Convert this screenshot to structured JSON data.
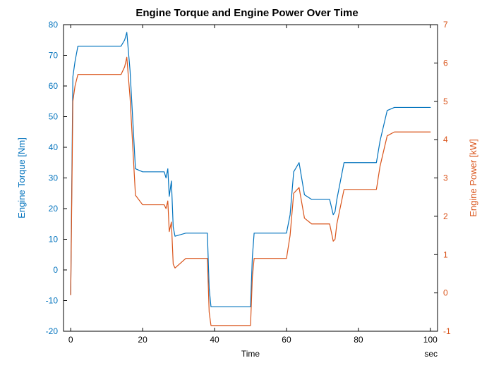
{
  "chart_data": {
    "type": "line",
    "title": "Engine Torque and Engine Power Over Time",
    "xlabel": "Time",
    "x_unit": "sec",
    "x_range": [
      -2,
      102
    ],
    "left_axis": {
      "label": "Engine Torque [Nm]",
      "color": "#0072BD",
      "range": [
        -20,
        80
      ],
      "ticks": [
        -20,
        -10,
        0,
        10,
        20,
        30,
        40,
        50,
        60,
        70,
        80
      ]
    },
    "right_axis": {
      "label": "Engine Power [kW]",
      "color": "#D95319",
      "range": [
        -1,
        7
      ],
      "ticks": [
        -1,
        0,
        1,
        2,
        3,
        4,
        5,
        6,
        7
      ]
    },
    "x_ticks": [
      0,
      20,
      40,
      60,
      80,
      100
    ],
    "series": [
      {
        "name": "Engine Torque [Nm]",
        "axis": "left",
        "color": "#0072BD",
        "x": [
          0,
          0.6,
          1.2,
          2,
          14,
          15,
          15.6,
          16.5,
          18,
          20,
          26,
          26.5,
          27,
          27.4,
          28,
          28.5,
          29,
          32,
          38,
          38.5,
          39,
          50,
          50.5,
          51,
          60,
          61,
          62,
          63.5,
          65,
          67,
          72,
          73,
          73.5,
          74,
          76,
          80,
          85,
          86,
          88,
          90,
          100
        ],
        "y": [
          -8,
          63,
          68,
          73,
          73,
          75,
          77.5,
          65,
          33,
          32,
          32,
          30,
          33,
          24,
          29,
          14,
          11,
          12,
          12,
          -6,
          -12,
          -12,
          4,
          12,
          12,
          18,
          32,
          35,
          24.5,
          23,
          23,
          18,
          19,
          23,
          35,
          35,
          35,
          42,
          52,
          53,
          53
        ]
      },
      {
        "name": "Engine Power [kW]",
        "axis": "right",
        "color": "#D95319",
        "x": [
          0,
          0.6,
          1.2,
          2,
          14,
          15,
          15.6,
          16.5,
          18,
          20,
          26,
          26.5,
          27,
          27.4,
          28,
          28.5,
          29,
          32,
          38,
          38.5,
          39,
          50,
          50.5,
          51,
          60,
          61,
          62,
          63.5,
          65,
          67,
          72,
          73,
          73.5,
          74,
          76,
          80,
          85,
          86,
          88,
          90,
          100
        ],
        "y": [
          -0.05,
          5.0,
          5.4,
          5.7,
          5.7,
          5.9,
          6.15,
          5.1,
          2.55,
          2.3,
          2.3,
          2.2,
          2.4,
          1.6,
          1.85,
          0.75,
          0.65,
          0.9,
          0.9,
          -0.5,
          -0.85,
          -0.85,
          0.4,
          0.9,
          0.9,
          1.5,
          2.6,
          2.75,
          1.95,
          1.8,
          1.8,
          1.35,
          1.4,
          1.8,
          2.7,
          2.7,
          2.7,
          3.3,
          4.1,
          4.2,
          4.2
        ]
      }
    ]
  }
}
